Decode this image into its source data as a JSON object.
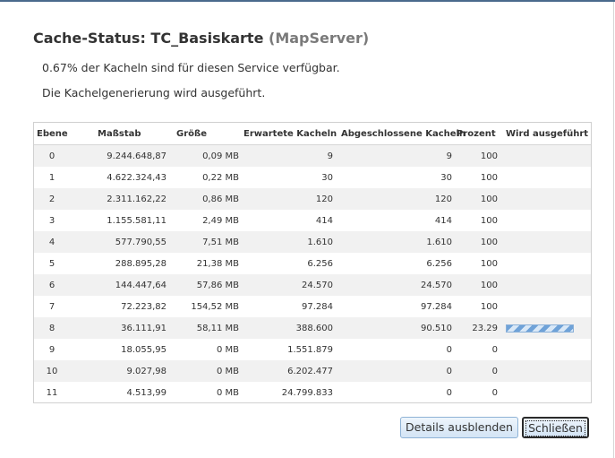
{
  "dialog": {
    "title_prefix": "Cache-Status: TC_Basiskarte",
    "title_service": "(MapServer)",
    "message_availability": "0.67% der Kacheln sind für diesen Service verfügbar.",
    "message_generation": "Die Kachelgenerierung wird ausgeführt."
  },
  "table": {
    "headers": {
      "level": "Ebene",
      "scale": "Maßstab",
      "size": "Größe",
      "expected": "Erwartete Kacheln",
      "completed": "Abgeschlossene Kacheln",
      "percent": "Prozent",
      "running": "Wird ausgeführt"
    },
    "rows": [
      {
        "level": "0",
        "scale": "9.244.648,87",
        "size": "0,09 MB",
        "expected": "9",
        "completed": "9",
        "percent": "100"
      },
      {
        "level": "1",
        "scale": "4.622.324,43",
        "size": "0,22 MB",
        "expected": "30",
        "completed": "30",
        "percent": "100"
      },
      {
        "level": "2",
        "scale": "2.311.162,22",
        "size": "0,86 MB",
        "expected": "120",
        "completed": "120",
        "percent": "100"
      },
      {
        "level": "3",
        "scale": "1.155.581,11",
        "size": "2,49 MB",
        "expected": "414",
        "completed": "414",
        "percent": "100"
      },
      {
        "level": "4",
        "scale": "577.790,55",
        "size": "7,51 MB",
        "expected": "1.610",
        "completed": "1.610",
        "percent": "100"
      },
      {
        "level": "5",
        "scale": "288.895,28",
        "size": "21,38 MB",
        "expected": "6.256",
        "completed": "6.256",
        "percent": "100"
      },
      {
        "level": "6",
        "scale": "144.447,64",
        "size": "57,86 MB",
        "expected": "24.570",
        "completed": "24.570",
        "percent": "100"
      },
      {
        "level": "7",
        "scale": "72.223,82",
        "size": "154,52 MB",
        "expected": "97.284",
        "completed": "97.284",
        "percent": "100"
      },
      {
        "level": "8",
        "scale": "36.111,91",
        "size": "58,11 MB",
        "expected": "388.600",
        "completed": "90.510",
        "percent": "23.29",
        "running": true
      },
      {
        "level": "9",
        "scale": "18.055,95",
        "size": "0 MB",
        "expected": "1.551.879",
        "completed": "0",
        "percent": "0"
      },
      {
        "level": "10",
        "scale": "9.027,98",
        "size": "0 MB",
        "expected": "6.202.477",
        "completed": "0",
        "percent": "0"
      },
      {
        "level": "11",
        "scale": "4.513,99",
        "size": "0 MB",
        "expected": "24.799.833",
        "completed": "0",
        "percent": "0"
      }
    ]
  },
  "buttons": {
    "details": "Details ausblenden",
    "close": "Schließen"
  },
  "colors": {
    "header_accent": "#4a6a8c",
    "row_stripe": "#f1f1f1",
    "progress": "#6fa2d8"
  }
}
